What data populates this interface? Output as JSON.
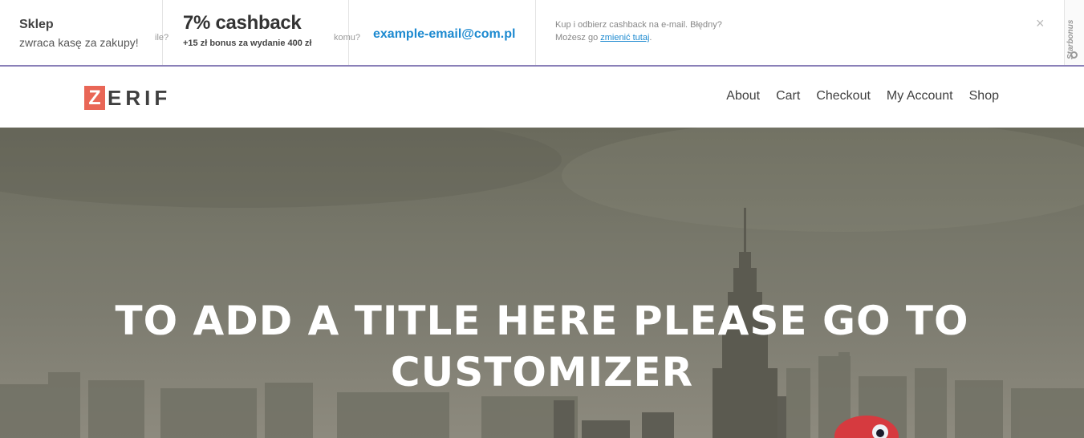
{
  "cashback_bar": {
    "shop_title": "Sklep",
    "shop_subtitle": "zwraca kasę za zakupy!",
    "question_how_much": "ile?",
    "cashback_title": "7% cashback",
    "cashback_bonus": "+15 zł bonus za wydanie 400 zł",
    "question_to_whom": "komu?",
    "email": "example-email@com.pl",
    "info_line1": "Kup i odbierz cashback na e-mail. Błędny?",
    "info_line2_prefix": "Możesz go ",
    "info_line2_link": "zmienić tutaj",
    "info_line2_suffix": ".",
    "close_icon": "×",
    "brand_vertical": "Starbonus",
    "accent_color": "#8a80b8",
    "link_color": "#1d8ad0"
  },
  "header": {
    "logo_first_letter": "Z",
    "logo_rest": "ERIF",
    "logo_accent": "#e96656",
    "nav": [
      {
        "label": "About"
      },
      {
        "label": "Cart"
      },
      {
        "label": "Checkout"
      },
      {
        "label": "My Account"
      },
      {
        "label": "Shop"
      }
    ]
  },
  "hero": {
    "title_line1": "TO ADD A TITLE HERE PLEASE GO TO",
    "title_line2": "CUSTOMIZER"
  }
}
